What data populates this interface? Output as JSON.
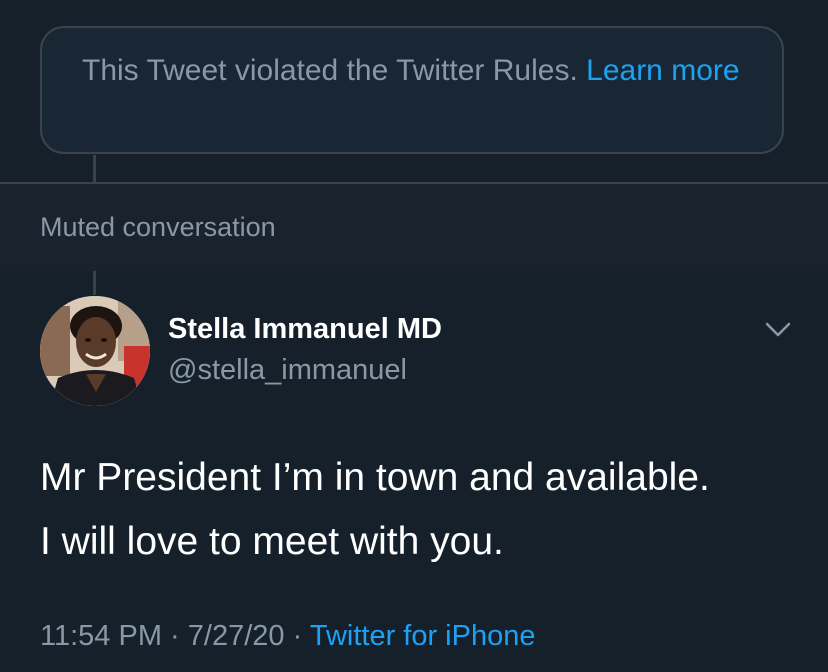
{
  "notice": {
    "text": "This Tweet violated the Twitter Rules.",
    "link_label": "Learn more"
  },
  "muted": {
    "label": "Muted conversation"
  },
  "tweet": {
    "author_name": "Stella Immanuel MD",
    "author_handle": "@stella_immanuel",
    "menu_icon": "chevron-down-icon",
    "text_line_1": "Mr President I’m in town and available.",
    "text_line_2": "I will love to meet with you.",
    "time": "11:54 PM",
    "date": "7/27/20",
    "separator": "·",
    "source": "Twitter for iPhone"
  },
  "colors": {
    "background": "#15202b",
    "muted_background": "#1a232d",
    "border": "#38444d",
    "secondary_text": "#8899a6",
    "link": "#1da1f2",
    "primary_text": "#ffffff"
  }
}
